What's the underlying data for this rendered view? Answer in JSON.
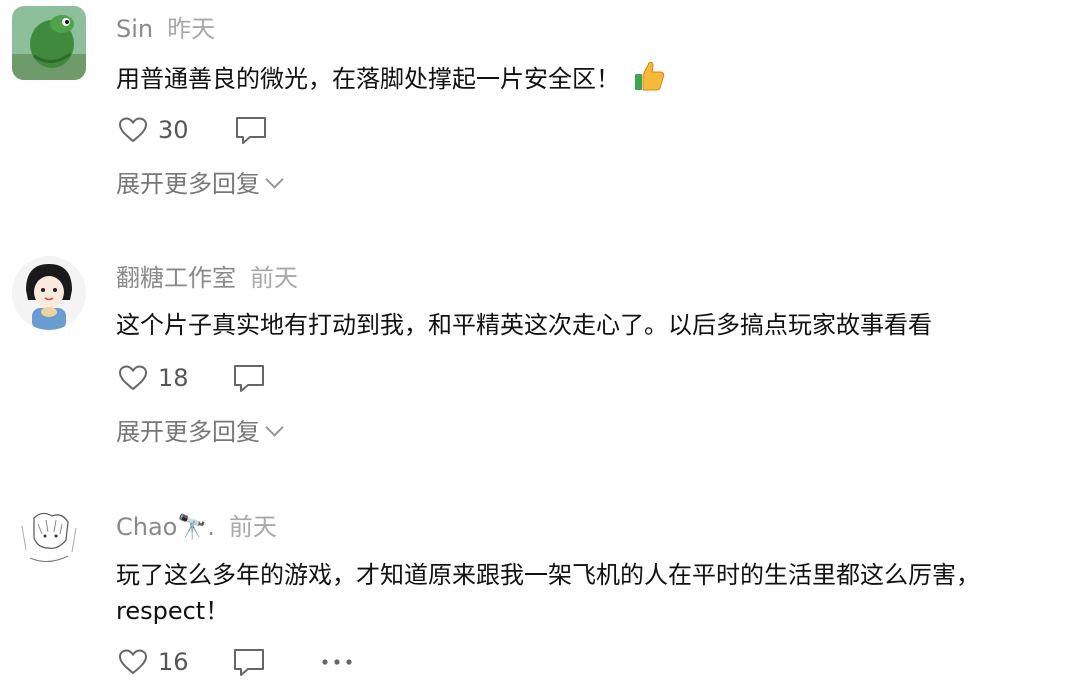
{
  "comments": [
    {
      "username": "Sin",
      "time": "昨天",
      "text": "用普通善良的微光，在落脚处撑起一片安全区！",
      "emoji": "thumbs-up",
      "likes": "30",
      "expand_label": "展开更多回复",
      "avatar_icon": "green-cartoon-frog-avatar"
    },
    {
      "username": "翻糖工作室",
      "time": "前天",
      "text": "这个片子真实地有打动到我，和平精英这次走心了。以后多搞点玩家故事看看",
      "likes": "18",
      "expand_label": "展开更多回复",
      "avatar_icon": "cartoon-girl-avatar"
    },
    {
      "username": "Chao🔭.",
      "time": "前天",
      "text": "玩了这么多年的游戏，才知道原来跟我一架飞机的人在平时的生活里都这么厉害，respect！",
      "likes": "16",
      "avatar_icon": "manga-sketch-avatar"
    }
  ]
}
